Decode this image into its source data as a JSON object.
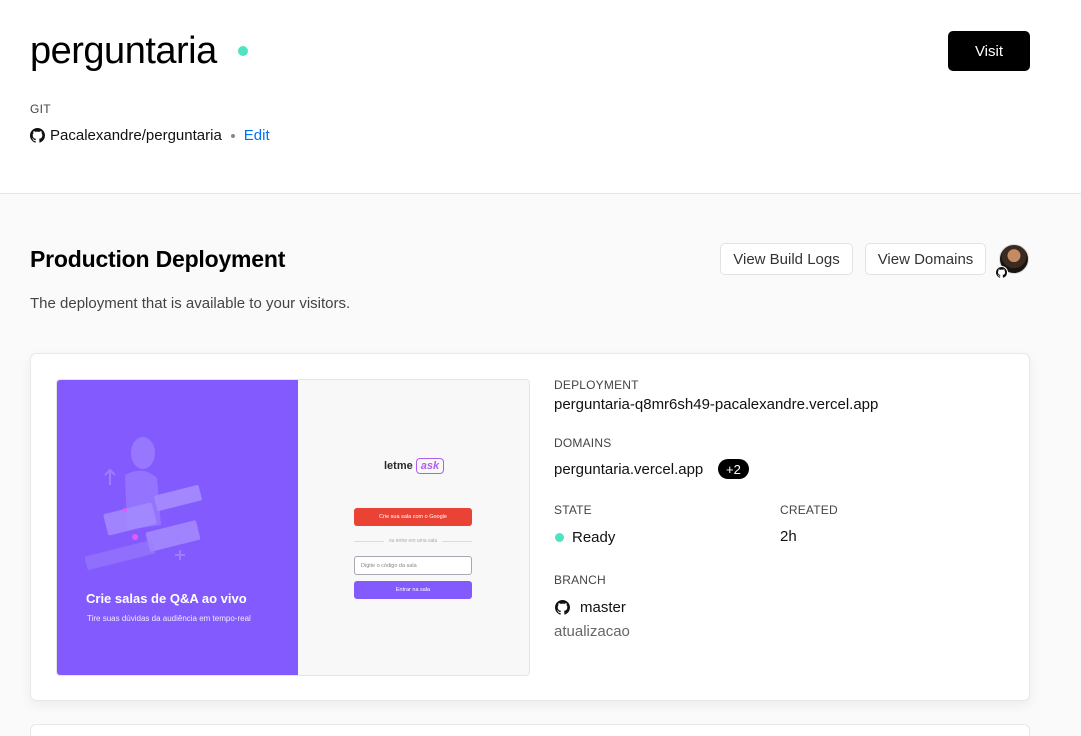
{
  "project": {
    "name": "perguntaria",
    "visit_label": "Visit",
    "git_label": "GIT",
    "repo": "Pacalexandre/perguntaria",
    "edit_label": "Edit",
    "status_color": "#50e3c2"
  },
  "production": {
    "title": "Production Deployment",
    "subtitle": "The deployment that is available to your visitors.",
    "build_logs_label": "View Build Logs",
    "domains_label": "View Domains"
  },
  "preview": {
    "headline": "Crie salas de Q&A ao vivo",
    "tagline": "Tire suas dúvidas da audiência em tempo-real",
    "logo_text": "letme",
    "logo_accent": "ask",
    "google_button": "Crie sua sala com o Google",
    "or_text": "ou entre em uma sala",
    "input_placeholder": "Digite o código da sala",
    "enter_button": "Entrar na sala",
    "brand_color": "#835afd"
  },
  "deployment": {
    "deployment_label": "DEPLOYMENT",
    "deployment_url": "perguntaria-q8mr6sh49-pacalexandre.vercel.app",
    "domains_label": "DOMAINS",
    "domain": "perguntaria.vercel.app",
    "extra_domains": "+2",
    "state_label": "STATE",
    "state": "Ready",
    "created_label": "CREATED",
    "created": "2h",
    "branch_label": "BRANCH",
    "branch": "master",
    "commit_message": "atualizacao"
  },
  "icons": {
    "github": "github-icon",
    "avatar": "user-avatar"
  }
}
